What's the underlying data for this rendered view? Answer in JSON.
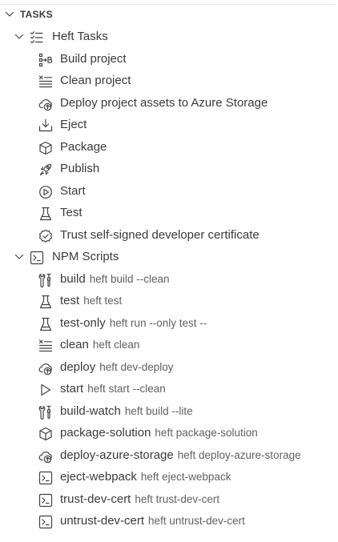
{
  "panel": {
    "title": "TASKS"
  },
  "groups": {
    "heft": {
      "label": "Heft Tasks",
      "items": [
        {
          "label": "Build project",
          "icon": "build-project-icon"
        },
        {
          "label": "Clean project",
          "icon": "clean-list-icon"
        },
        {
          "label": "Deploy project assets to Azure Storage",
          "icon": "cloud-upload-icon"
        },
        {
          "label": "Eject",
          "icon": "eject-download-icon"
        },
        {
          "label": "Package",
          "icon": "package-icon"
        },
        {
          "label": "Publish",
          "icon": "rocket-icon"
        },
        {
          "label": "Start",
          "icon": "play-circle-icon"
        },
        {
          "label": "Test",
          "icon": "beaker-icon"
        },
        {
          "label": "Trust self-signed developer certificate",
          "icon": "verified-badge-icon"
        }
      ]
    },
    "npm": {
      "label": "NPM Scripts",
      "items": [
        {
          "label": "build",
          "desc": "heft build --clean",
          "icon": "tools-icon"
        },
        {
          "label": "test",
          "desc": "heft test",
          "icon": "beaker-icon"
        },
        {
          "label": "test-only",
          "desc": "heft run --only test --",
          "icon": "beaker-icon"
        },
        {
          "label": "clean",
          "desc": "heft clean",
          "icon": "clean-list-icon"
        },
        {
          "label": "deploy",
          "desc": "heft dev-deploy",
          "icon": "cloud-upload-icon"
        },
        {
          "label": "start",
          "desc": "heft start --clean",
          "icon": "play-icon"
        },
        {
          "label": "build-watch",
          "desc": "heft build --lite",
          "icon": "tools-icon"
        },
        {
          "label": "package-solution",
          "desc": "heft package-solution",
          "icon": "package-icon"
        },
        {
          "label": "deploy-azure-storage",
          "desc": "heft deploy-azure-storage",
          "icon": "cloud-upload-icon"
        },
        {
          "label": "eject-webpack",
          "desc": "heft eject-webpack",
          "icon": "terminal-icon"
        },
        {
          "label": "trust-dev-cert",
          "desc": "heft trust-dev-cert",
          "icon": "terminal-icon"
        },
        {
          "label": "untrust-dev-cert",
          "desc": "heft untrust-dev-cert",
          "icon": "terminal-icon"
        }
      ]
    }
  }
}
